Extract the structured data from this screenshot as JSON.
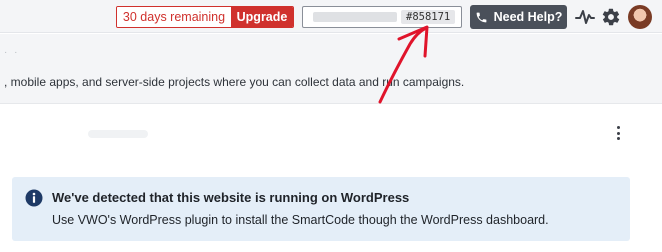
{
  "topbar": {
    "trial_text": "30 days remaining",
    "upgrade_label": "Upgrade",
    "account_id": "#858171",
    "help_label": "Need Help?",
    "icons": [
      "phone-icon",
      "activity-icon",
      "gear-icon",
      "avatar"
    ]
  },
  "subheader": {
    "description": ", mobile apps, and server-side projects where you can collect data and run campaigns."
  },
  "notice": {
    "title": "We've detected that this website is running on WordPress",
    "body": "Use VWO's WordPress plugin to install the SmartCode though the WordPress dashboard.",
    "icon": "info-icon"
  },
  "colors": {
    "accent_red": "#d0312d",
    "help_button": "#4a505a",
    "notice_bg": "#e4eef8",
    "annotation": "#e0142b"
  }
}
